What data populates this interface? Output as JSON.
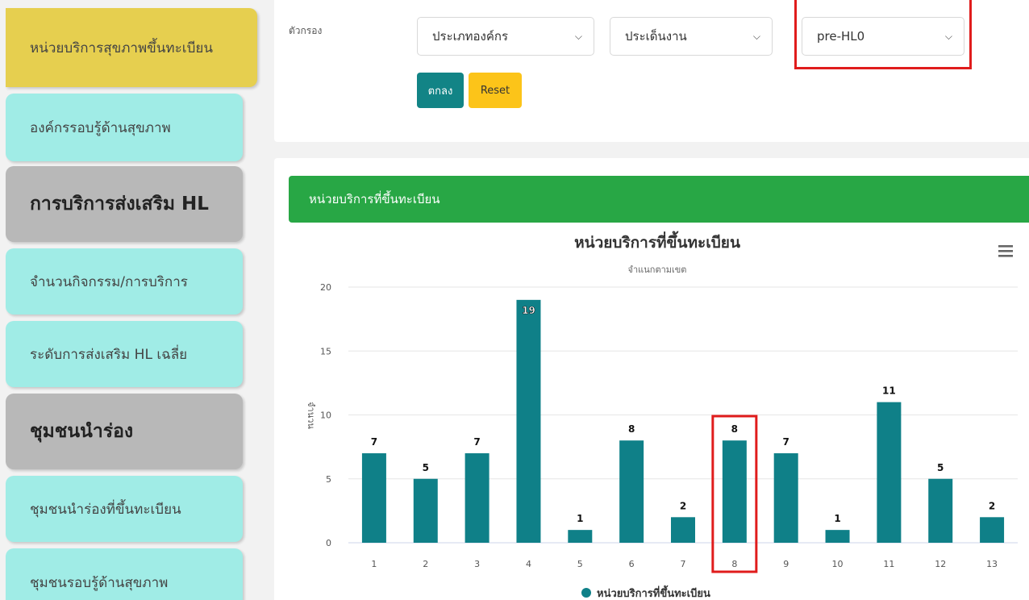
{
  "sidebar": {
    "items": [
      {
        "label": "หน่วยบริการสุขภาพขึ้นทะเบียน"
      },
      {
        "label": "องค์กรรอบรู้ด้านสุขภาพ"
      },
      {
        "label": "การบริการส่งเสริม HL"
      },
      {
        "label": "จำนวนกิจกรรม/การบริการ"
      },
      {
        "label": "ระดับการส่งเสริม HL เฉลี่ย"
      },
      {
        "label": "ชุมชนนำร่อง"
      },
      {
        "label": "ชุมชนนำร่องที่ขึ้นทะเบียน"
      },
      {
        "label": "ชุมชนรอบรู้ด้านสุขภาพ"
      }
    ]
  },
  "filter": {
    "label": "ตัวกรอง",
    "org_type": "ประเภทองค์กร",
    "issue": "ประเด็นงาน",
    "level": "pre-HL0",
    "ok_label": "ตกลง",
    "reset_label": "Reset"
  },
  "panel": {
    "header": "หน่วยบริการที่ขึ้นทะเบียน"
  },
  "chart_data": {
    "type": "bar",
    "title": "หน่วยบริการที่ขึ้นทะเบียน",
    "subtitle": "จำแนกตามเขต",
    "xlabel": "",
    "ylabel": "จำนวน",
    "categories": [
      "1",
      "2",
      "3",
      "4",
      "5",
      "6",
      "7",
      "8",
      "9",
      "10",
      "11",
      "12",
      "13"
    ],
    "series": [
      {
        "name": "หน่วยบริการที่ขึ้นทะเบียน",
        "values": [
          7,
          5,
          7,
          19,
          1,
          8,
          2,
          8,
          7,
          1,
          11,
          5,
          2
        ],
        "color": "#0f8088"
      }
    ],
    "ylim": [
      0,
      20
    ],
    "yticks": [
      0,
      5,
      10,
      15,
      20
    ],
    "grid": true,
    "legend": "bottom",
    "highlight_category": "8"
  },
  "colors": {
    "bar": "#0f8088",
    "highlight": "#e01c1c",
    "header": "#28a745"
  },
  "icons": {
    "chart_menu": "hamburger-menu-icon"
  }
}
